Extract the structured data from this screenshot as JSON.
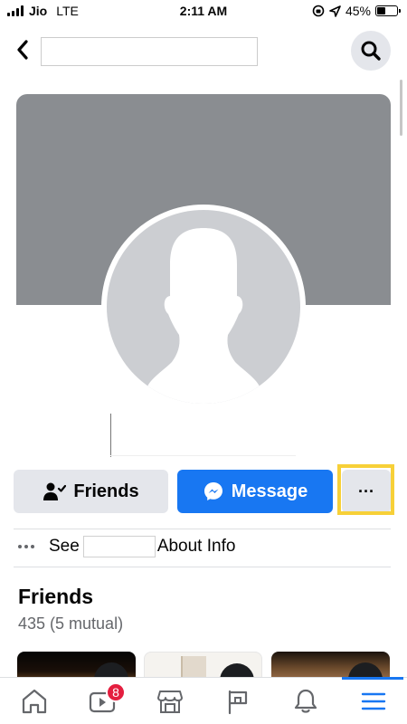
{
  "status_bar": {
    "carrier": "Jio",
    "network": "LTE",
    "time": "2:11 AM",
    "battery_percent": "45%",
    "battery_level": 0.45
  },
  "header": {
    "back_icon": "chevron-left-icon",
    "search_value": "",
    "search_icon": "search-icon"
  },
  "profile": {
    "name": "",
    "cover_color": "#8a8d91",
    "avatar_color": "#ccced2"
  },
  "actions": {
    "friends_label": "Friends",
    "message_label": "Message",
    "more_label": "···",
    "accent": "#1877f2",
    "highlight_color": "#f7d038"
  },
  "about": {
    "prefix": "See",
    "name": "",
    "suffix": "About Info"
  },
  "friends": {
    "title": "Friends",
    "count": "435 (5 mutual)"
  },
  "bottom_nav": {
    "items": [
      {
        "icon": "home-icon"
      },
      {
        "icon": "watch-video-icon",
        "badge": "8"
      },
      {
        "icon": "marketplace-icon"
      },
      {
        "icon": "pages-flag-icon"
      },
      {
        "icon": "notifications-bell-icon"
      },
      {
        "icon": "menu-icon",
        "active": true
      }
    ]
  }
}
